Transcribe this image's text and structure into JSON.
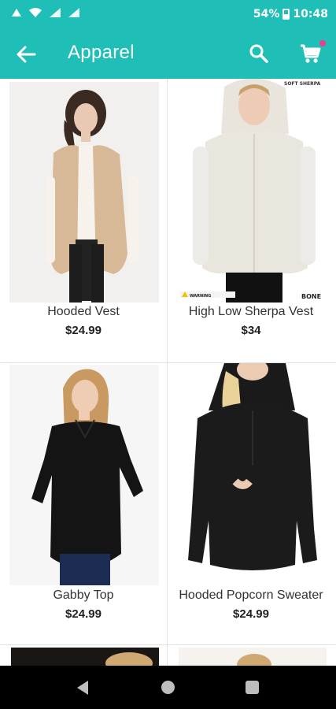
{
  "status_bar": {
    "battery": "54%",
    "time": "10:48"
  },
  "app_bar": {
    "title": "Apparel"
  },
  "products": [
    {
      "name": "Hooded Vest",
      "price": "$24.99"
    },
    {
      "name": "High Low Sherpa Vest",
      "price": "$34",
      "image_text": [
        "SOFT SHERPA",
        "BONE",
        "WARNING"
      ]
    },
    {
      "name": "Gabby Top",
      "price": "$24.99"
    },
    {
      "name": "Hooded Popcorn Sweater",
      "price": "$24.99"
    }
  ],
  "colors": {
    "accent": "#1fbfb8",
    "cart_badge": "#f03c8e"
  }
}
